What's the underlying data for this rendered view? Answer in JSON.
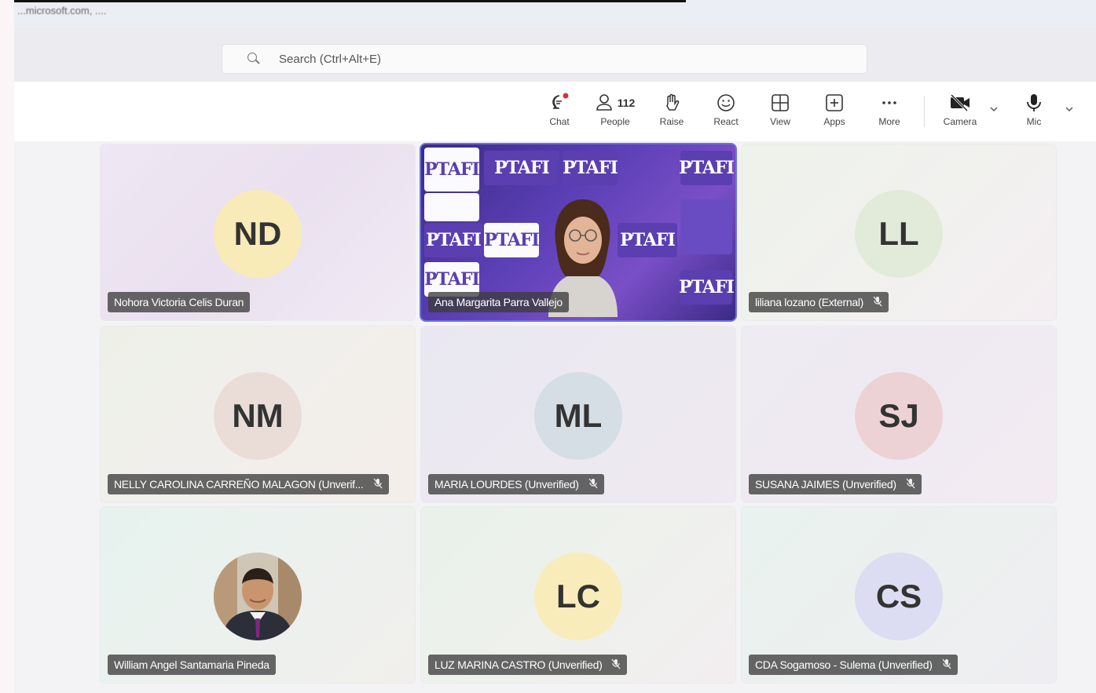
{
  "top": {
    "crumb": "...microsoft.com, ...."
  },
  "search": {
    "placeholder": "Search (Ctrl+Alt+E)"
  },
  "toolbar": {
    "chat": "Chat",
    "people": "People",
    "people_count": "112",
    "raise": "Raise",
    "react": "React",
    "view": "View",
    "apps": "Apps",
    "more": "More",
    "camera": "Camera",
    "mic": "Mic"
  },
  "video_brand": "PTAFI",
  "participants": [
    {
      "initials": "ND",
      "name": "Nohora Victoria Celis Duran",
      "muted": false,
      "avatar_bg": "#f8ebb8"
    },
    {
      "initials": "",
      "name": "Ana Margarita Parra Vallejo",
      "muted": false,
      "video": true
    },
    {
      "initials": "LL",
      "name": "liliana lozano (External)",
      "muted": true,
      "avatar_bg": "#e2ead9"
    },
    {
      "initials": "NM",
      "name": "NELLY CAROLINA CARREÑO MALAGON (Unverif...",
      "muted": true,
      "avatar_bg": "#eadcd7"
    },
    {
      "initials": "ML",
      "name": "MARIA LOURDES (Unverified)",
      "muted": true,
      "avatar_bg": "#d5dde5"
    },
    {
      "initials": "SJ",
      "name": "SUSANA JAIMES (Unverified)",
      "muted": true,
      "avatar_bg": "#ecd2d4"
    },
    {
      "initials": "",
      "name": "William Angel Santamaria Pineda",
      "muted": false,
      "photo": true
    },
    {
      "initials": "LC",
      "name": "LUZ MARINA CASTRO (Unverified)",
      "muted": true,
      "avatar_bg": "#f8ecbb"
    },
    {
      "initials": "CS",
      "name": "CDA Sogamoso - Sulema (Unverified)",
      "muted": true,
      "avatar_bg": "#dcdcf2"
    }
  ]
}
